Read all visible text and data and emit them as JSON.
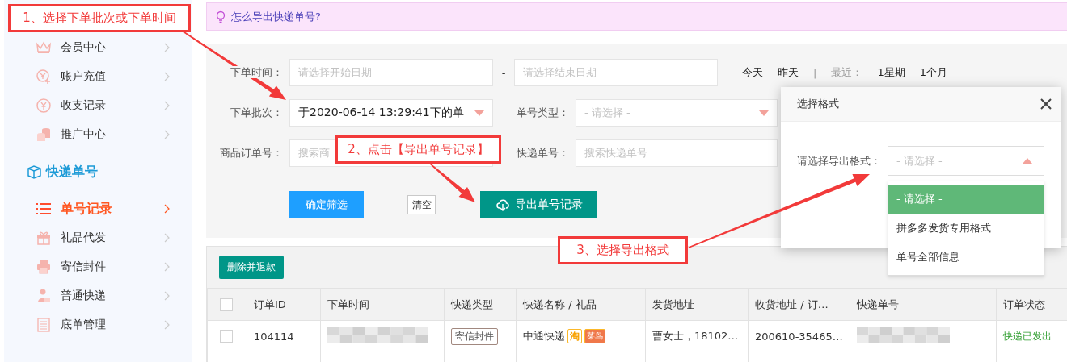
{
  "annotations": [
    {
      "text": "1、选择下单批次或下单时间"
    },
    {
      "text": "2、点击【导出单号记录】"
    },
    {
      "text": "3、选择导出格式"
    }
  ],
  "sidebar": {
    "groups": [
      {
        "items": [
          {
            "label": "会员中心",
            "selected": false
          },
          {
            "label": "账户充值",
            "selected": false
          },
          {
            "label": "收支记录",
            "selected": false
          },
          {
            "label": "推广中心",
            "selected": false
          }
        ]
      },
      {
        "title": "快递单号",
        "items": [
          {
            "label": "单号记录",
            "selected": true
          },
          {
            "label": "礼品代发",
            "selected": false
          },
          {
            "label": "寄信封件",
            "selected": false
          },
          {
            "label": "普通快递",
            "selected": false
          },
          {
            "label": "底单管理",
            "selected": false
          }
        ]
      }
    ]
  },
  "tip": {
    "text": "怎么导出快递单号?"
  },
  "filters": {
    "order_time": {
      "label": "下单时间：",
      "start_placeholder": "请选择开始日期",
      "separator": "-",
      "end_placeholder": "请选择结束日期"
    },
    "quick_ranges": [
      "今天",
      "昨天"
    ],
    "divider": "|",
    "recent_label": "最近：",
    "recent_ranges": [
      "1星期",
      "1个月"
    ],
    "batch": {
      "label": "下单批次：",
      "value": "于2020-06-14 13:29:41下的单"
    },
    "number_type": {
      "label": "单号类型：",
      "placeholder": "- 请选择 -"
    },
    "product_order": {
      "label": "商品订单号：",
      "placeholder": "搜索商"
    },
    "tracking": {
      "label": "快递单号：",
      "placeholder": "搜索快递单号"
    },
    "buttons": {
      "confirm": "确定筛选",
      "clear": "清空",
      "export": "导出单号记录"
    }
  },
  "table": {
    "toolbar_button": "删除并退款",
    "header_checked": false,
    "columns": [
      "订单ID",
      "下单时间",
      "快递类型",
      "快递名称 / 礼品",
      "发货地址",
      "收货地址 / 订…",
      "快递单号",
      "订单状态"
    ],
    "rows": [
      {
        "checked": false,
        "order_id": "104114",
        "type_tag": "寄信封件",
        "courier": "中通快递",
        "badges": [
          {
            "text": "淘",
            "kind": "outline"
          },
          {
            "text": "菜鸟",
            "kind": "filled"
          }
        ],
        "sender": "曹女士，18102…",
        "receiver": "200610-35465…",
        "status": "快递已发出"
      }
    ]
  },
  "modal": {
    "title": "选择格式",
    "label": "请选择导出格式：",
    "placeholder": "- 请选择 -",
    "expanded": true,
    "options": [
      {
        "label": "- 请选择 -",
        "selected": true
      },
      {
        "label": "拼多多发货专用格式",
        "selected": false
      },
      {
        "label": "单号全部信息",
        "selected": false
      }
    ]
  }
}
